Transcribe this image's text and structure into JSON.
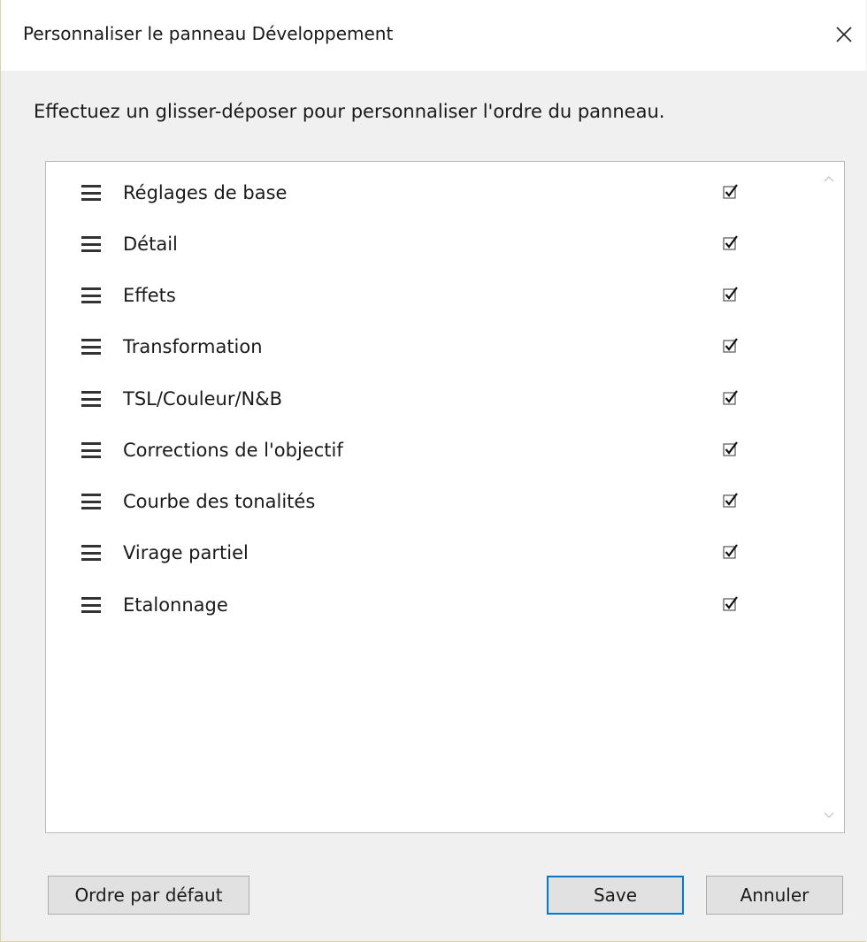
{
  "window": {
    "title": "Personnaliser le panneau Développement",
    "close_icon": "close-icon"
  },
  "instruction": "Effectuez un glisser-déposer pour personnaliser l'ordre du panneau.",
  "panels": [
    {
      "label": "Réglages de base",
      "checked": true
    },
    {
      "label": "Détail",
      "checked": true
    },
    {
      "label": "Effets",
      "checked": true
    },
    {
      "label": "Transformation",
      "checked": true
    },
    {
      "label": "TSL/Couleur/N&B",
      "checked": true
    },
    {
      "label": "Corrections de l'objectif",
      "checked": true
    },
    {
      "label": "Courbe des tonalités",
      "checked": true
    },
    {
      "label": "Virage partiel",
      "checked": true
    },
    {
      "label": "Etalonnage",
      "checked": true
    }
  ],
  "buttons": {
    "default_order": "Ordre par défaut",
    "save": "Save",
    "cancel": "Annuler"
  },
  "colors": {
    "accent": "#0078d7",
    "background": "#f0f0f0"
  }
}
